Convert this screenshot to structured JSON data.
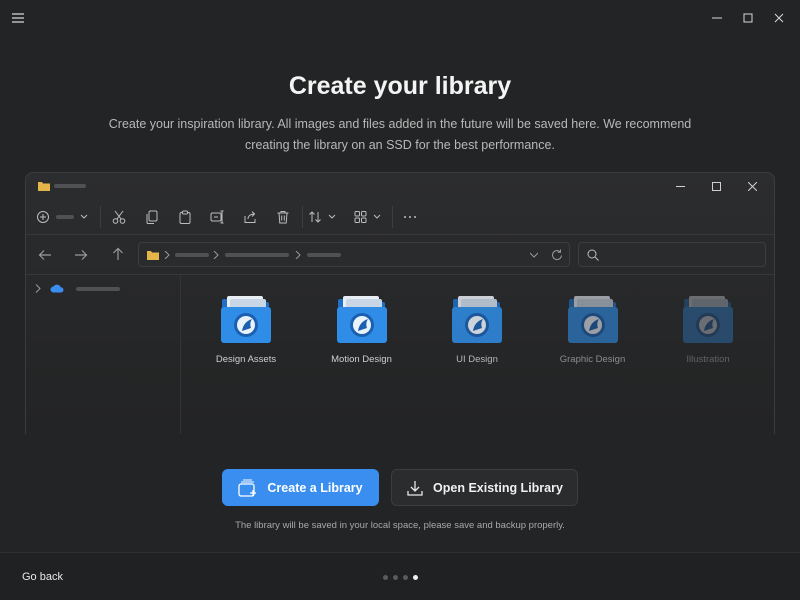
{
  "header": {
    "title": "Create your library",
    "subtitle": "Create your inspiration library. All images and files added in the future will be saved here. We recommend creating the library on an SSD for the best performance."
  },
  "icons": {
    "menu": "hamburger-icon",
    "minimize": "minimize-icon",
    "maximize": "maximize-icon",
    "close": "close-icon"
  },
  "preview": {
    "folders": [
      {
        "label": "Design Assets",
        "opacity": 1.0
      },
      {
        "label": "Motion Design",
        "opacity": 1.0
      },
      {
        "label": "UI Design",
        "opacity": 0.85
      },
      {
        "label": "Graphic Design",
        "opacity": 0.6
      },
      {
        "label": "Illustration",
        "opacity": 0.35
      }
    ]
  },
  "actions": {
    "create_label": "Create a Library",
    "open_label": "Open Existing Library",
    "note": "The library will be saved in your local space, please save and backup properly."
  },
  "footer": {
    "back_label": "Go back",
    "steps_total": 4,
    "step_current": 4
  },
  "colors": {
    "accent": "#3a8ef0",
    "background": "#232425",
    "folder_blue": "#2f8de8"
  }
}
